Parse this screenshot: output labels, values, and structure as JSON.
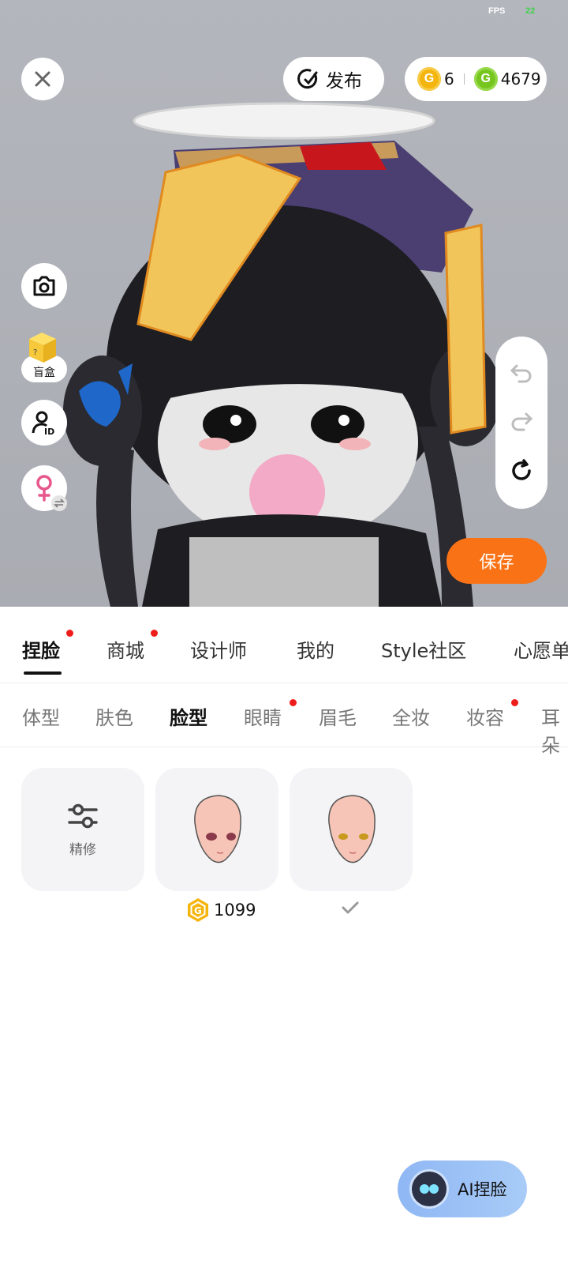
{
  "status": {
    "fps_label": "FPS",
    "fps_value": "22"
  },
  "top_bar": {
    "publish_label": "发布",
    "coins_gold": "6",
    "coins_green": "4679"
  },
  "side_tools": {
    "blind_box_label": "盲盒"
  },
  "save_label": "保存",
  "main_tabs": [
    {
      "label": "捏脸",
      "active": true,
      "dot": true
    },
    {
      "label": "商城",
      "dot": true
    },
    {
      "label": "设计师"
    },
    {
      "label": "我的"
    },
    {
      "label": "Style社区"
    },
    {
      "label": "心愿单"
    }
  ],
  "sub_tabs": [
    {
      "label": "体型"
    },
    {
      "label": "肤色"
    },
    {
      "label": "脸型",
      "active": true
    },
    {
      "label": "眼睛",
      "dot": true
    },
    {
      "label": "眉毛"
    },
    {
      "label": "全妆"
    },
    {
      "label": "妆容",
      "dot": true
    },
    {
      "label": "耳朵"
    }
  ],
  "items": {
    "fine_tune_label": "精修",
    "item1_price": "1099"
  },
  "ai_button_label": "AI捏脸",
  "colors": {
    "accent": "#f97316",
    "gold_coin": "#f5b50f",
    "green_coin": "#76c61f",
    "red_dot": "#ef1c1c"
  }
}
